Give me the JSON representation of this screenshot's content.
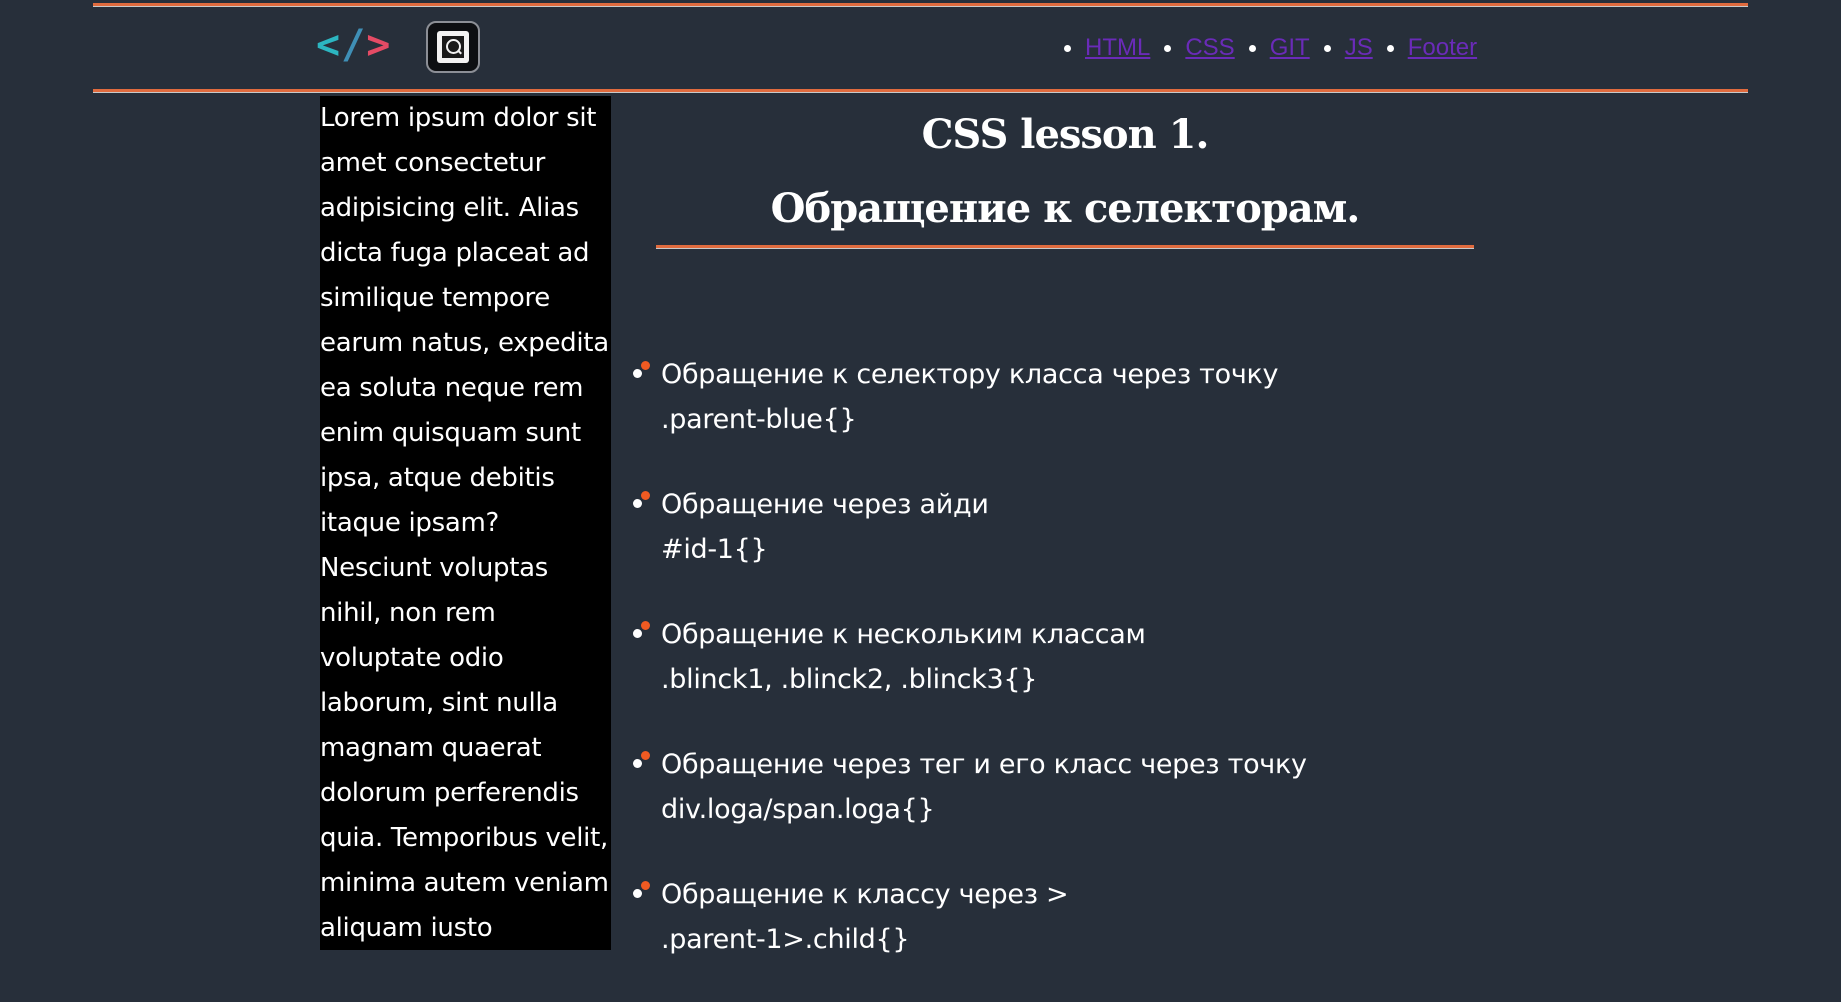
{
  "header": {
    "logo": {
      "lt": "<",
      "slash": "/",
      "gt": ">"
    },
    "search_icon": "search-icon",
    "nav": [
      {
        "label": "HTML"
      },
      {
        "label": "CSS"
      },
      {
        "label": "GIT"
      },
      {
        "label": "JS"
      },
      {
        "label": "Footer"
      }
    ]
  },
  "sidebar": {
    "text": "Lorem ipsum dolor sit amet consectetur adipisicing elit. Alias dicta fuga placeat ad similique tempore earum natus, expedita ea soluta neque rem enim quisquam sunt ipsa, atque debitis itaque ipsam? Nesciunt voluptas nihil, non rem voluptate odio laborum, sint nulla magnam quaerat dolorum perferendis quia. Temporibus velit, minima autem veniam aliquam iusto"
  },
  "main": {
    "title_line1": "CSS lesson 1.",
    "title_line2": "Обращение к селекторам.",
    "lessons": [
      {
        "heading": "Обращение к селектору класса через точку",
        "code": ".parent-blue{}"
      },
      {
        "heading": "Обращение через айди",
        "code": "#id-1{}"
      },
      {
        "heading": "Обращение к нескольким классам",
        "code": ".blinck1, .blinck2, .blinck3{}"
      },
      {
        "heading": "Обращение через тег и его класс через точку",
        "code": "div.loga/span.loga{}"
      },
      {
        "heading": "Обращение к классу через >",
        "code": ".parent-1>.child{}"
      }
    ]
  },
  "colors": {
    "background": "#272f3a",
    "accent_line": "#e06b3e",
    "bullet_orange": "#f05a22",
    "nav_link": "#6a2bb8"
  }
}
